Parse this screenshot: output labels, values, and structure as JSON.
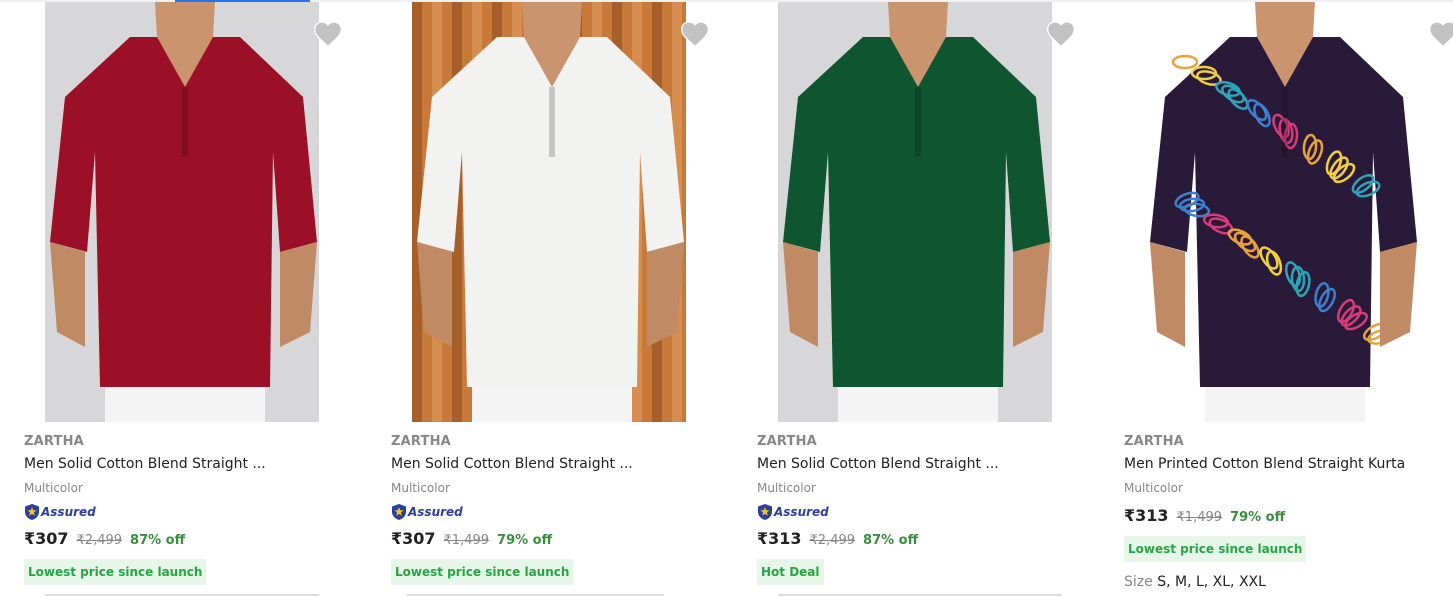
{
  "products": [
    {
      "brand": "ZARTHA",
      "title": "Men Solid Cotton Blend Straight ...",
      "color": "Multicolor",
      "assured": "Assured",
      "price": "₹307",
      "mrp": "₹2,499",
      "discount": "87% off",
      "deal": "Lowest price since launch",
      "shirt_color": "#9c1027",
      "bg_color": "#d7d7da"
    },
    {
      "brand": "ZARTHA",
      "title": "Men Solid Cotton Blend Straight ...",
      "color": "Multicolor",
      "assured": "Assured",
      "price": "₹307",
      "mrp": "₹1,499",
      "discount": "79% off",
      "deal": "Lowest price since launch",
      "shirt_color": "#f2f2f0",
      "bg_color": "#c8793a"
    },
    {
      "brand": "ZARTHA",
      "title": "Men Solid Cotton Blend Straight ...",
      "color": "Multicolor",
      "assured": "Assured",
      "price": "₹313",
      "mrp": "₹2,499",
      "discount": "87% off",
      "deal": "Hot Deal",
      "shirt_color": "#0f5530",
      "bg_color": "#d7d7da"
    },
    {
      "brand": "ZARTHA",
      "title": "Men Printed Cotton Blend Straight Kurta",
      "color": "Multicolor",
      "price": "₹313",
      "mrp": "₹1,499",
      "discount": "79% off",
      "deal": "Lowest price since launch",
      "size_label": "Size",
      "sizes": "S, M, L, XL, XXL",
      "shirt_color": "#2a1a3a",
      "bg_color": "#ffffff"
    }
  ],
  "icons": {
    "wishlist": "heart-icon",
    "assured": "shield-icon"
  },
  "colors": {
    "accent": "#2874f0",
    "discount": "#388e3c",
    "deal_bg": "#e6f7ea",
    "deal_text": "#26a541"
  }
}
